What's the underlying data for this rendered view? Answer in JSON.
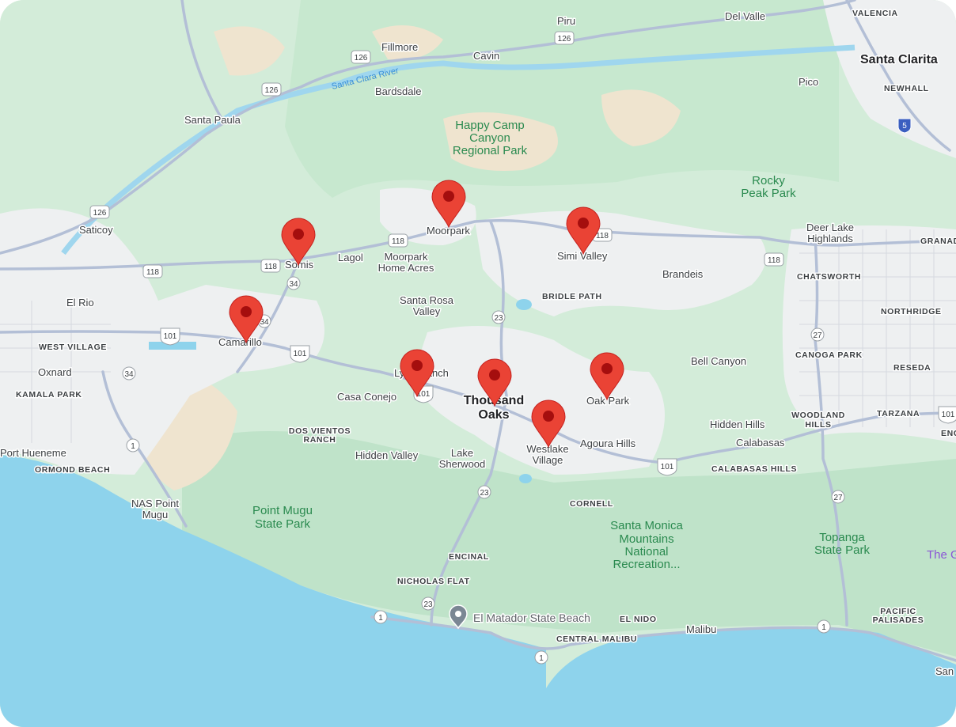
{
  "map": {
    "labels": {
      "valencia": "VALENCIA",
      "del_valle": "Del Valle",
      "piru": "Piru",
      "santa_clarita": "Santa Clarita",
      "newhall": "NEWHALL",
      "pico": "Pico",
      "fillmore": "Fillmore",
      "cavin": "Cavin",
      "santa_clara_river": "Santa Clara River",
      "bardsdale": "Bardsdale",
      "santa_paula": "Santa Paula",
      "happy_camp_1": "Happy Camp",
      "happy_camp_2": "Canyon",
      "happy_camp_3": "Regional Park",
      "rocky_peak_1": "Rocky",
      "rocky_peak_2": "Peak Park",
      "saticoy": "Saticoy",
      "moorpark": "Moorpark",
      "simi_valley": "Simi Valley",
      "deer_lake_1": "Deer Lake",
      "deer_lake_2": "Highlands",
      "granada": "GRANAD",
      "somis": "Somis",
      "lagol": "Lagol",
      "moorpark_home_1": "Moorpark",
      "moorpark_home_2": "Home Acres",
      "brandeis": "Brandeis",
      "chatsworth": "CHATSWORTH",
      "el_rio": "El Rio",
      "bridle_path": "BRIDLE PATH",
      "santa_rosa_1": "Santa Rosa",
      "santa_rosa_2": "Valley",
      "northridge": "NORTHRIDGE",
      "camarillo": "Camarillo",
      "west_village": "WEST VILLAGE",
      "canoga_park": "CANOGA PARK",
      "bell_canyon": "Bell Canyon",
      "reseda": "RESEDA",
      "oxnard": "Oxnard",
      "lyn_ranch": "Lynn Ranch",
      "thousand_oaks_1": "Thousand",
      "thousand_oaks_2": "Oaks",
      "oak_park": "Oak Park",
      "kamala_park": "KAMALA PARK",
      "casa_conejo": "Casa Conejo",
      "woodland_hills_1": "WOODLAND",
      "woodland_hills_2": "HILLS",
      "tarzana": "TARZANA",
      "enc": "ENC",
      "dos_vientos_1": "DOS VIENTOS",
      "dos_vientos_2": "RANCH",
      "hidden_hills": "Hidden Hills",
      "calabasas": "Calabasas",
      "agoura_hills": "Agoura Hills",
      "port_hueneme": "Port Hueneme",
      "hidden_valley": "Hidden Valley",
      "lake_sherwood_1": "Lake",
      "lake_sherwood_2": "Sherwood",
      "westlake_1": "Westlake",
      "westlake_2": "Village",
      "calabasas_hills": "CALABASAS HILLS",
      "ormond_beach": "ORMOND BEACH",
      "nas_point_1": "NAS Point",
      "nas_point_2": "Mugu",
      "cornell": "CORNELL",
      "point_mugu_1": "Point Mugu",
      "point_mugu_2": "State Park",
      "santa_monica_1": "Santa Monica",
      "santa_monica_2": "Mountains",
      "santa_monica_3": "National",
      "santa_monica_4": "Recreation...",
      "topanga_1": "Topanga",
      "topanga_2": "State Park",
      "the_g": "The G",
      "encinal": "ENCINAL",
      "nicholas_flat": "NICHOLAS FLAT",
      "el_matador": "El Matador State Beach",
      "el_nido": "EL NIDO",
      "pacific_pal_1": "PACIFIC",
      "pacific_pal_2": "PALISADES",
      "central_malibu": "CENTRAL MALIBU",
      "malibu": "Malibu",
      "san": "San"
    },
    "shields": {
      "r126a": "126",
      "r126b": "126",
      "r126c": "126",
      "r126d": "126",
      "r118a": "118",
      "r118b": "118",
      "r118c": "118",
      "r118d": "118",
      "r118e": "118",
      "r34a": "34",
      "r34b": "34",
      "r34c": "34",
      "r101a": "101",
      "r101b": "101",
      "r101c": "101",
      "r101d": "101",
      "r101e": "101",
      "r23a": "23",
      "r23b": "23",
      "r23c": "23",
      "r27": "27",
      "r27b": "27",
      "r1a": "1",
      "r1b": "1",
      "r1c": "1",
      "r1d": "1",
      "r5": "5"
    },
    "pins": [
      {
        "place": "Moorpark",
        "color": "#ea4335"
      },
      {
        "place": "Simi Valley",
        "color": "#ea4335"
      },
      {
        "place": "Somis",
        "color": "#ea4335"
      },
      {
        "place": "Camarillo",
        "color": "#ea4335"
      },
      {
        "place": "Lynn Ranch",
        "color": "#ea4335"
      },
      {
        "place": "Thousand Oaks",
        "color": "#ea4335"
      },
      {
        "place": "Oak Park",
        "color": "#ea4335"
      },
      {
        "place": "Westlake Village",
        "color": "#ea4335"
      }
    ],
    "colors": {
      "ocean": "#8ed3ec",
      "land_green": "#cbebd4",
      "urban": "#f1f3f4",
      "road": "#b9c3d8",
      "pin": "#ea4335",
      "pin_center": "#a50e0e"
    }
  }
}
